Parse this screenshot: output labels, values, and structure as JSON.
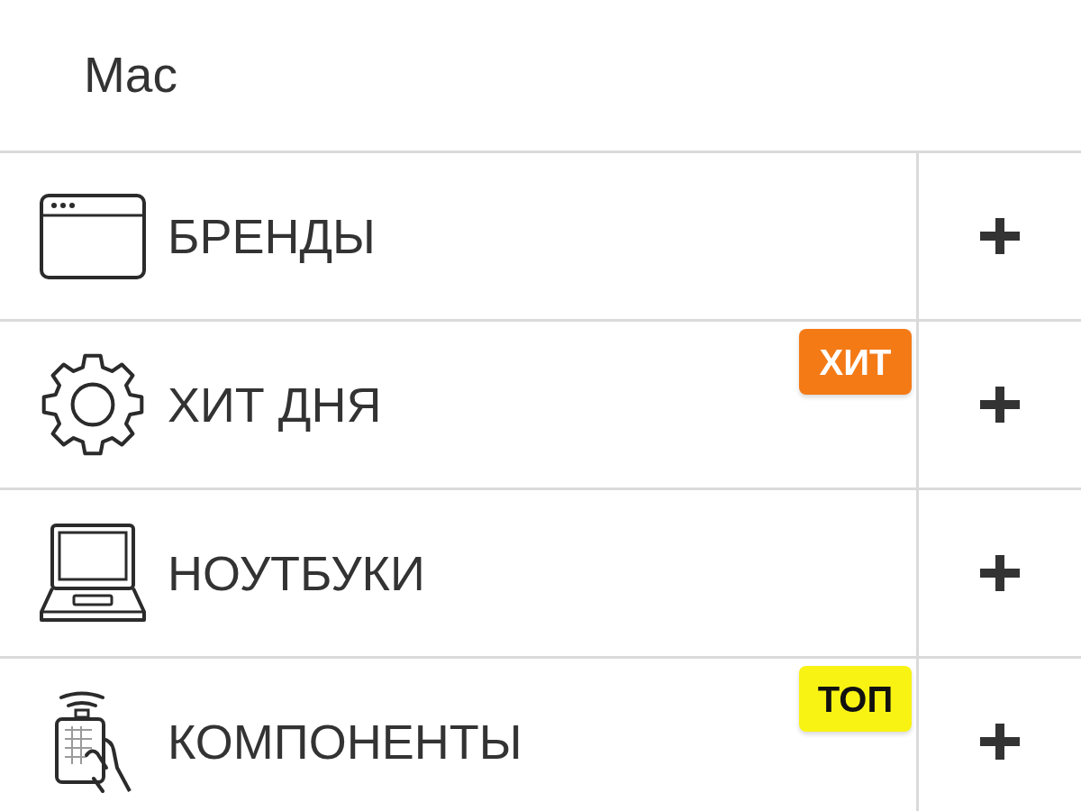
{
  "header": {
    "title": "Mac"
  },
  "menu": {
    "items": [
      {
        "label": "БРЕНДЫ",
        "expanded": false
      },
      {
        "label": "ХИТ ДНЯ",
        "expanded": false,
        "badge": {
          "text": "ХИТ",
          "color": "#f47a16"
        }
      },
      {
        "label": "НОУТБУКИ",
        "expanded": false
      },
      {
        "label": "КОМПОНЕНТЫ",
        "expanded": false,
        "badge": {
          "text": "ТОП",
          "color": "#f8f313"
        }
      }
    ]
  }
}
